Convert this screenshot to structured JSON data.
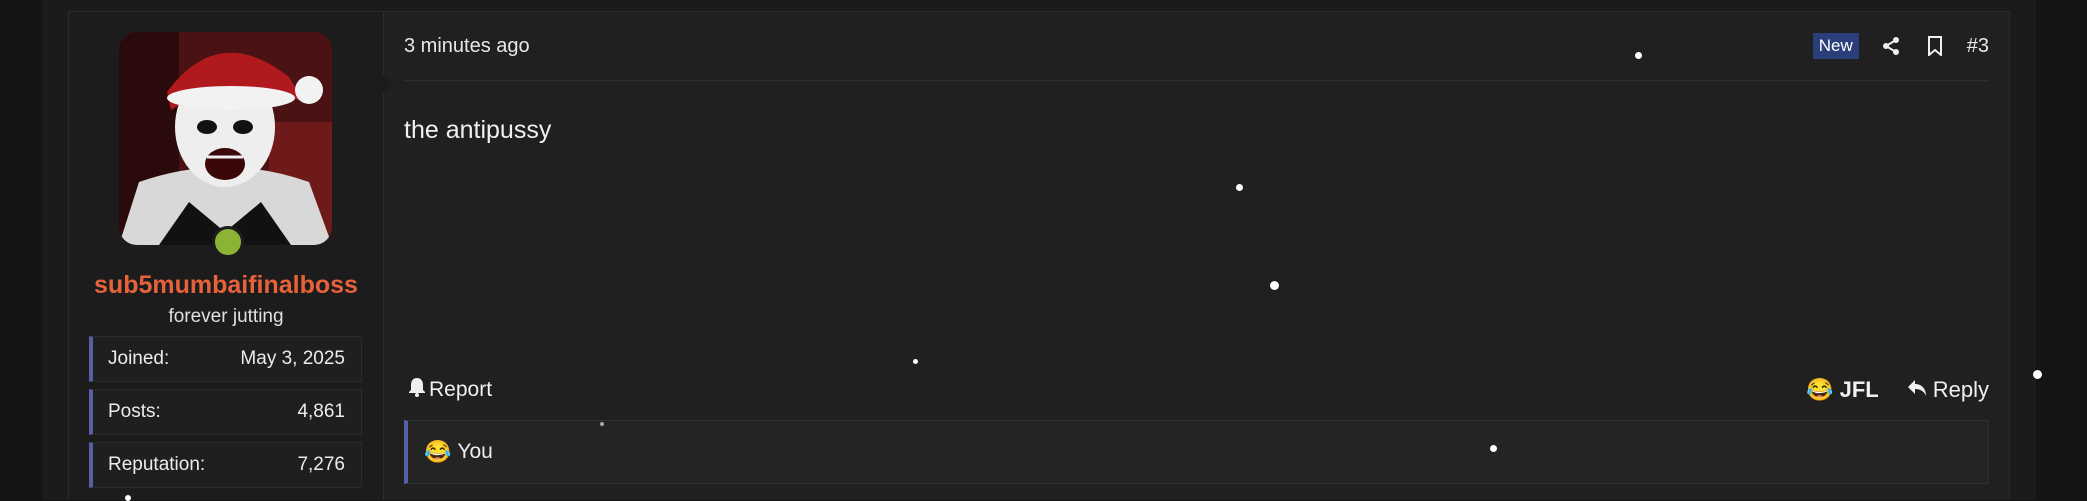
{
  "user": {
    "username": "sub5mumbaifinalboss",
    "title": "forever jutting",
    "online": true,
    "stats": [
      {
        "label": "Joined:",
        "value": "May 3, 2025"
      },
      {
        "label": "Posts:",
        "value": "4,861"
      },
      {
        "label": "Reputation:",
        "value": "7,276"
      }
    ]
  },
  "post": {
    "timestamp": "3 minutes ago",
    "badge": "New",
    "number": "#3",
    "body": "the antipussy",
    "actions": {
      "report": "Report",
      "react_label": "JFL",
      "react_emoji": "😂",
      "reply": "Reply"
    },
    "reactions": {
      "emoji": "😂",
      "text": "You"
    }
  },
  "colors": {
    "username": "#e6623a",
    "accent_bar": "#5560a8",
    "new_badge": "#2a3f7a",
    "online": "#8bb435"
  },
  "icons": [
    "share-icon",
    "bookmark-icon",
    "bell-icon",
    "reply-arrow-icon"
  ]
}
